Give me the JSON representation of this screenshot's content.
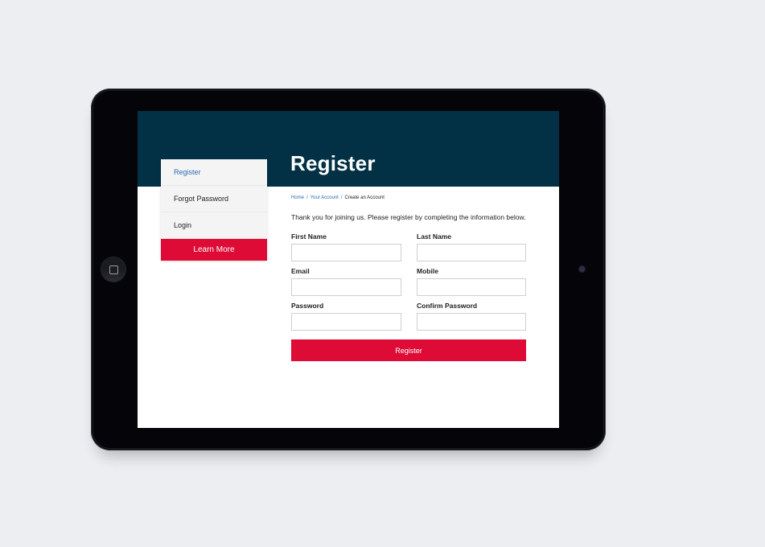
{
  "page": {
    "title": "Register"
  },
  "sidebar": {
    "items": [
      {
        "label": "Register",
        "active": true
      },
      {
        "label": "Forgot Password",
        "active": false
      },
      {
        "label": "Login",
        "active": false
      }
    ],
    "cta_label": "Learn More"
  },
  "breadcrumb": {
    "items": [
      "Home",
      "Your Account",
      "Create an Account"
    ],
    "separator": "/"
  },
  "intro_text": "Thank you for joining us. Please register by completing the information below.",
  "form": {
    "fields": {
      "first_name": {
        "label": "First Name",
        "value": ""
      },
      "last_name": {
        "label": "Last Name",
        "value": ""
      },
      "email": {
        "label": "Email",
        "value": ""
      },
      "mobile": {
        "label": "Mobile",
        "value": ""
      },
      "password": {
        "label": "Password",
        "value": ""
      },
      "confirm_password": {
        "label": "Confirm Password",
        "value": ""
      }
    },
    "submit_label": "Register"
  },
  "colors": {
    "banner": "#023145",
    "accent": "#de0b36",
    "link": "#2e6db3"
  },
  "device": {
    "home_button_icon": "home-button-icon",
    "camera_icon": "camera-icon"
  }
}
